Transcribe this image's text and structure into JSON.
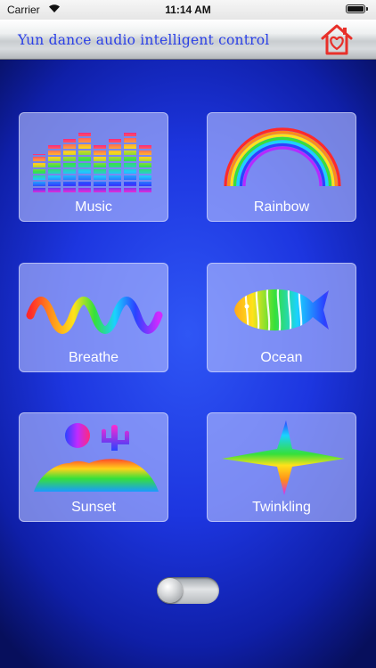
{
  "status_bar": {
    "carrier": "Carrier",
    "time": "11:14 AM"
  },
  "header": {
    "title": "Yun dance audio intelligent control",
    "home_icon": "home-heart-icon"
  },
  "modes": [
    {
      "label": "Music",
      "icon": "equalizer-icon"
    },
    {
      "label": "Rainbow",
      "icon": "rainbow-icon"
    },
    {
      "label": "Breathe",
      "icon": "wave-icon"
    },
    {
      "label": "Ocean",
      "icon": "fish-icon"
    },
    {
      "label": "Sunset",
      "icon": "desert-sunset-icon"
    },
    {
      "label": "Twinkling",
      "icon": "star-icon"
    }
  ],
  "power_toggle": {
    "on": false
  },
  "colors": {
    "title": "#2a3fe6",
    "home_icon": "#e8302a",
    "tile_label": "#ffffff"
  }
}
